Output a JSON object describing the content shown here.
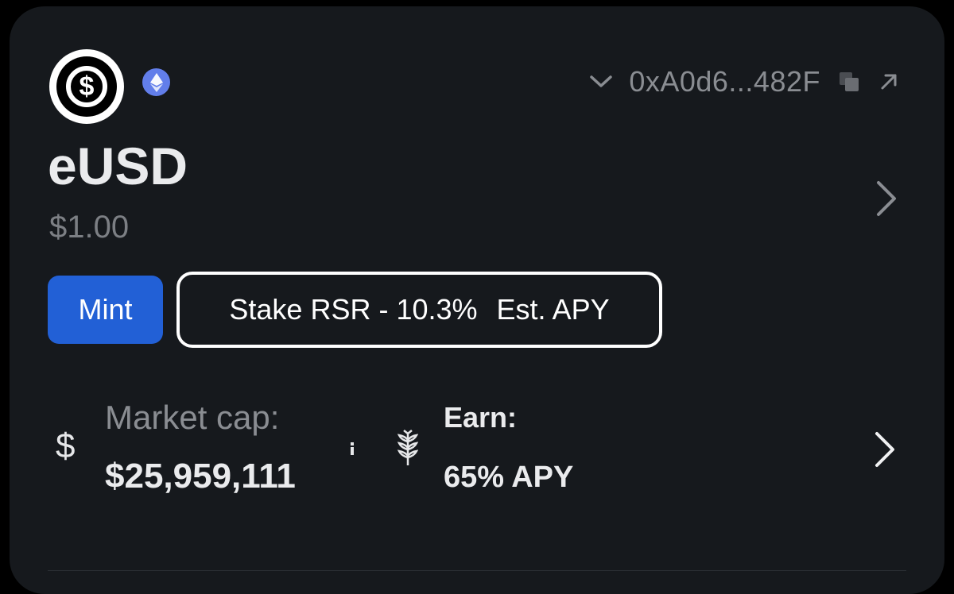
{
  "token": {
    "symbol": "eUSD",
    "price": "$1.00",
    "logo_icon": "dollar-circle-icon",
    "chain_icon": "ethereum-icon"
  },
  "address": {
    "text": "0xA0d6...482F",
    "expand_icon": "chevron-down-icon",
    "copy_icon": "copy-icon",
    "external_icon": "external-link-icon"
  },
  "actions": {
    "mint_label": "Mint",
    "stake_label": "Stake RSR - 10.3%",
    "stake_suffix": "Est. APY"
  },
  "stats": {
    "market_cap_label": "Market cap:",
    "market_cap_value": "$25,959,111",
    "earn_label": "Earn:",
    "earn_value": "65% APY"
  },
  "colors": {
    "background": "#16191d",
    "mint_button": "#2260d6",
    "ethereum": "#627eea",
    "muted_text": "#8a8d92"
  }
}
